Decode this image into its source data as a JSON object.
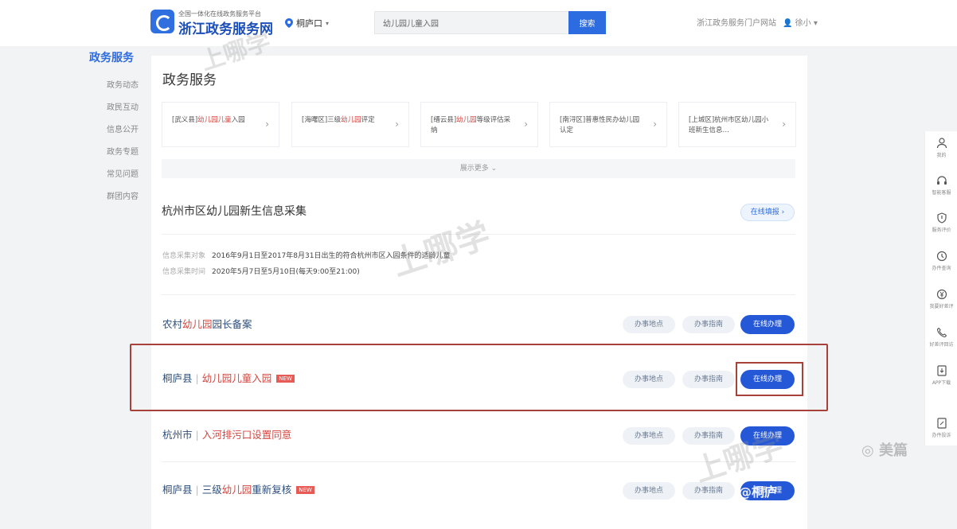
{
  "header": {
    "logo_sub": "全国一体化在线政务服务平台",
    "logo_title": "浙江政务服务网",
    "location": "桐庐口",
    "search_value": "幼儿园儿童入园",
    "search_button": "搜索",
    "right_text": "浙江政务服务门户网站",
    "user": "徐小"
  },
  "leftnav": {
    "active": "政务服务",
    "items": [
      "政务动态",
      "政民互动",
      "信息公开",
      "政务专题",
      "常见问题",
      "群团内容"
    ]
  },
  "main": {
    "section_title": "政务服务",
    "cards": [
      {
        "prefix": "[武义县]",
        "hl": "幼儿园儿童",
        "suffix": "入园"
      },
      {
        "prefix": "[海曙区]三级",
        "hl": "幼儿园",
        "suffix": "评定"
      },
      {
        "prefix": "[缙云县]",
        "hl": "幼儿园",
        "suffix": "等级评估采纳"
      },
      {
        "prefix": "[南浔区]普惠性民办",
        "hl": "",
        "suffix": "幼儿园认定"
      },
      {
        "prefix": "[上城区]杭州市区幼儿园小班新生信息…",
        "hl": "",
        "suffix": ""
      }
    ],
    "show_more": "展示更多",
    "service_title": "杭州市区幼儿园新生信息采集",
    "online_fill": "在线填报",
    "info_label_1": "信息采集对象",
    "info_value_1": "2016年9月1日至2017年8月31日出生的符合杭州市区入园条件的适龄儿童",
    "info_label_2": "信息采集时间",
    "info_value_2": "2020年5月7日至5月10日(每天9:00至21:00)",
    "rows": [
      {
        "region": "",
        "pre": "农村",
        "hl": "幼儿园",
        "post": "园长备案",
        "new": false
      },
      {
        "region": "桐庐县",
        "pre": "",
        "hl": "幼儿园儿童入园",
        "post": "",
        "new": true
      },
      {
        "region": "杭州市",
        "pre": "入河排污口设置同意",
        "hl": "",
        "post": "",
        "new": false
      },
      {
        "region": "桐庐县",
        "pre": "三级",
        "hl": "幼儿园",
        "post": "重新复核",
        "new": true
      }
    ],
    "btn_point": "办事地点",
    "btn_guide": "办事指南",
    "btn_online": "在线办理",
    "tag_new": "NEW"
  },
  "rightbar": {
    "items": [
      "我的",
      "智能客服",
      "服务评价",
      "办件查询",
      "我要好差评",
      "好差评回访",
      "APP下载",
      "办件投诉"
    ]
  },
  "watermarks": {
    "brand": "上哪学",
    "meipian": "美篇",
    "handle": "@桐庐"
  }
}
